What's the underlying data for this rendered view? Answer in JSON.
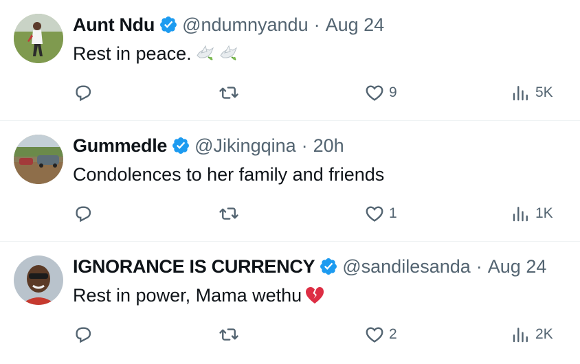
{
  "tweets": [
    {
      "name": "Aunt Ndu",
      "handle": "@ndumnyandu",
      "separator": "·",
      "time": "Aug 24",
      "text": "Rest in peace.",
      "emojis": [
        "dove-icon",
        "dove-icon"
      ],
      "likes": "9",
      "views": "5K"
    },
    {
      "name": "Gummedle",
      "handle": "@Jikingqina",
      "separator": "·",
      "time": "20h",
      "text": "Condolences to her family and friends",
      "emojis": [],
      "likes": "1",
      "views": "1K"
    },
    {
      "name": "IGNORANCE IS CURRENCY",
      "handle": "@sandilesanda",
      "separator": "·",
      "time": "Aug 24",
      "text": "Rest in power, Mama wethu",
      "emojis": [
        "broken-heart-icon"
      ],
      "likes": "2",
      "views": "2K"
    }
  ],
  "colors": {
    "verified": "#1d9bf0",
    "secondary_text": "#536471",
    "primary_text": "#0f1419",
    "divider": "#eff3f4"
  }
}
